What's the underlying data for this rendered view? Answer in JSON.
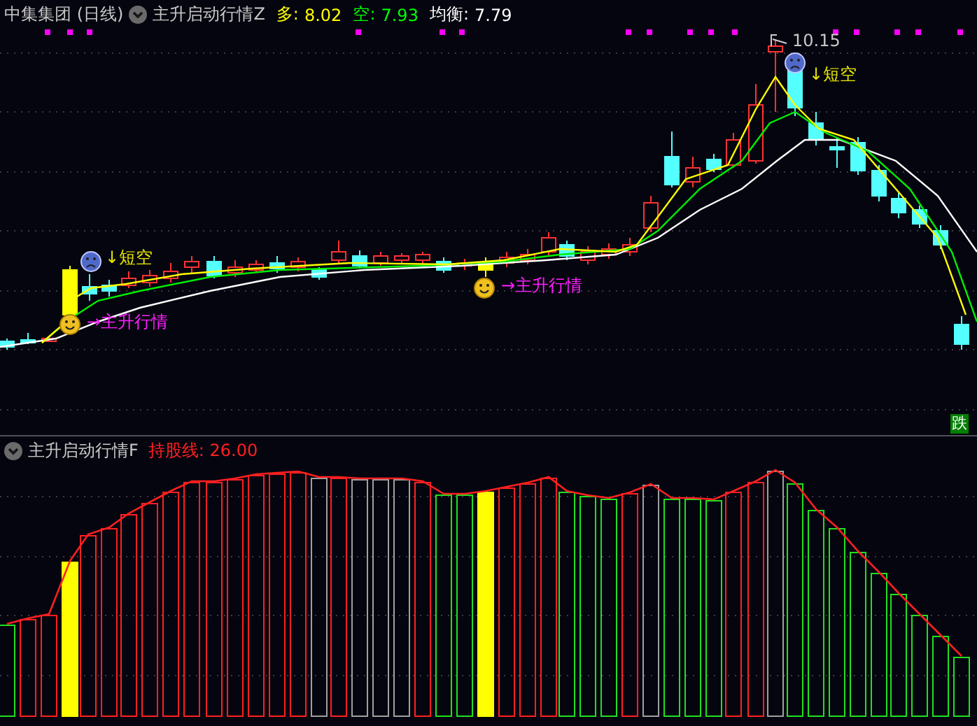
{
  "chart_header": {
    "symbol": "中集集团 (日线)",
    "indicator": "主升启动行情Z",
    "legend": [
      {
        "label": "多:",
        "value": "8.02",
        "color": "#ffff00"
      },
      {
        "label": "空:",
        "value": "7.93",
        "color": "#00ff00"
      },
      {
        "label": "均衡:",
        "value": "7.79",
        "color": "#ffffff"
      }
    ]
  },
  "price_chart": {
    "high_label": "10.15",
    "signals": [
      {
        "kind": "buy",
        "text": "→主升行情"
      },
      {
        "kind": "sell",
        "text": "↓短空"
      },
      {
        "kind": "buy",
        "text": "→主升行情"
      },
      {
        "kind": "sell",
        "text": "↓短空"
      }
    ],
    "badge": "跌"
  },
  "indicator_panel": {
    "title": "主升启动行情F",
    "line_label": "持股线: 26.00"
  }
}
